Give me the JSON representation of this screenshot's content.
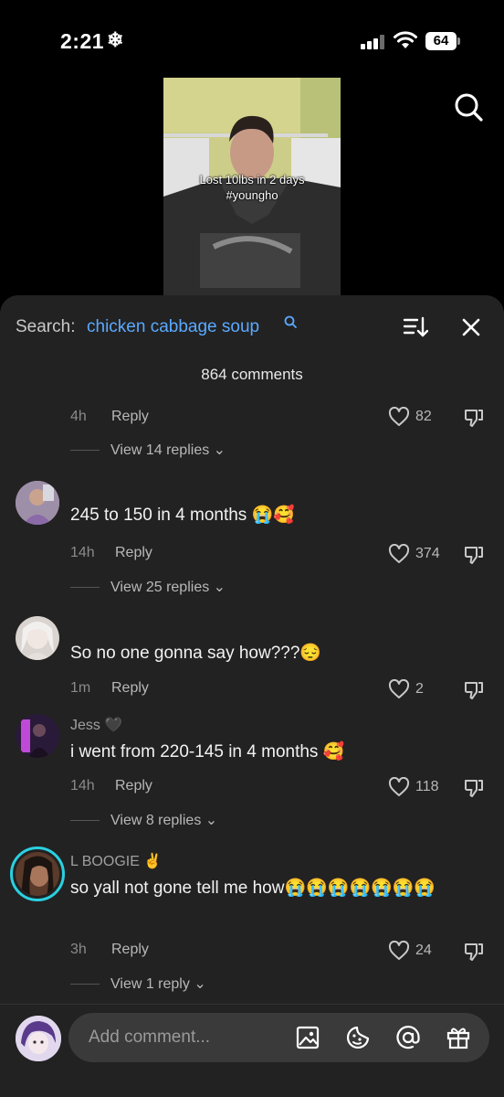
{
  "status_bar": {
    "time": "2:21",
    "battery": "64"
  },
  "video": {
    "caption_line1": "Lost 10lbs in 2 days",
    "caption_line2": "#youngho"
  },
  "sheet": {
    "search_label": "Search:",
    "search_query": "chicken cabbage soup",
    "comment_count": "864 comments"
  },
  "comments": [
    {
      "age": "4h",
      "reply": "Reply",
      "likes": "82",
      "view_replies": "View 14 replies"
    },
    {
      "text": "245 to 150 in 4 months 😭🥰",
      "age": "14h",
      "reply": "Reply",
      "likes": "374",
      "view_replies": "View 25 replies"
    },
    {
      "text": "So no one gonna say how???😔",
      "age": "1m",
      "reply": "Reply",
      "likes": "2"
    },
    {
      "username": "Jess 🖤",
      "text": "i went from 220-145 in 4 months 🥰",
      "age": "14h",
      "reply": "Reply",
      "likes": "118",
      "view_replies": "View 8 replies"
    },
    {
      "username": "L BOOGIE ✌️",
      "text": "so yall not gone tell me how😭😭😭😭😭😭😭",
      "age": "3h",
      "reply": "Reply",
      "likes": "24",
      "view_replies": "View 1 reply"
    }
  ],
  "composer": {
    "placeholder": "Add comment..."
  },
  "colors": {
    "sheet_bg": "#222222",
    "accent_link": "#5aa9ff",
    "input_bg": "#3a3a3a"
  }
}
